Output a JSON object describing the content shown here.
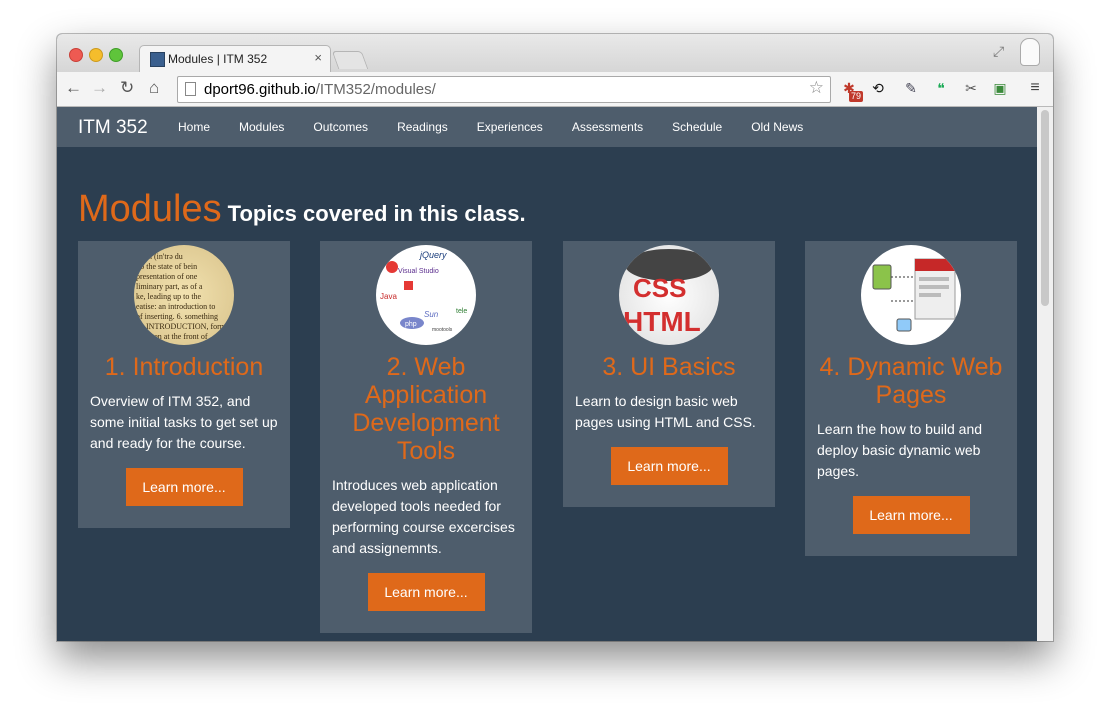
{
  "browser": {
    "tab_title": "Modules | ITM 352",
    "tab_close": "×",
    "url_host": "dport96.github.io",
    "url_path": "/ITM352/modules/",
    "extension_badge": "79"
  },
  "site": {
    "brand": "ITM 352",
    "nav": [
      "Home",
      "Modules",
      "Outcomes",
      "Readings",
      "Experiences",
      "Assessments",
      "Schedule",
      "Old News"
    ]
  },
  "page": {
    "title": "Modules",
    "subtitle": "Topics covered in this class."
  },
  "modules": [
    {
      "title": "1. Introduction",
      "description": "Overview of ITM 352, and some initial tasks to get set up and ready for the course.",
      "button": "Learn more...",
      "image_label": "dictionary-page-image"
    },
    {
      "title": "2. Web Application Development Tools",
      "description": "Introduces web application developed tools needed for performing course excercises and assignemnts.",
      "button": "Learn more...",
      "image_label": "dev-tools-logos-image"
    },
    {
      "title": "3. UI Basics",
      "description": "Learn to design basic web pages using HTML and CSS.",
      "button": "Learn more...",
      "image_label": "css-html-image"
    },
    {
      "title": "4. Dynamic Web Pages",
      "description": "Learn the how to build and deploy basic dynamic web pages.",
      "button": "Learn more...",
      "image_label": "dynamic-pages-diagram-image"
    }
  ],
  "colors": {
    "accent": "#df691a",
    "background": "#2c3e50",
    "panel": "#4e5d6c"
  }
}
